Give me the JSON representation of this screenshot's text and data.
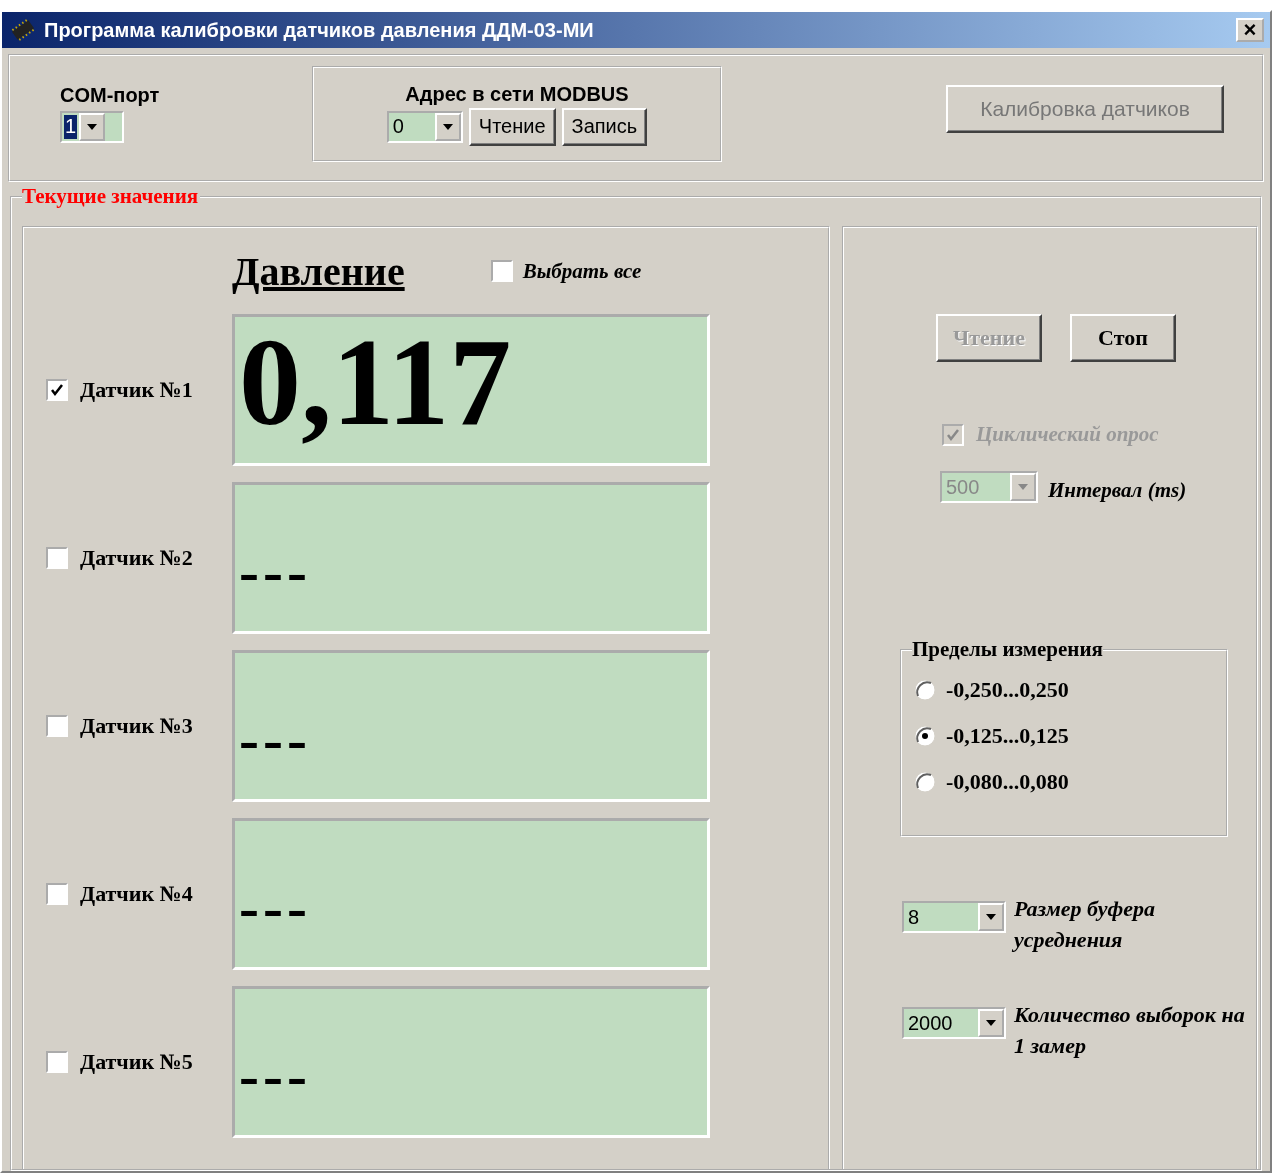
{
  "window": {
    "title": "Программа калибровки датчиков давления ДДМ-03-МИ",
    "close": "×"
  },
  "com_port": {
    "label": "COM-порт",
    "value": "1"
  },
  "modbus": {
    "label": "Адрес в сети MODBUS",
    "address": "0",
    "buttons": [
      "Чтение",
      "Запись"
    ]
  },
  "calibrate_button": "Калибровка датчиков",
  "group_title": "Текущие значения",
  "pressure_heading": "Давление",
  "select_all": {
    "label": "Выбрать все",
    "checked": false
  },
  "sensors": [
    {
      "label": "Датчик №1",
      "checked": true,
      "value": "0,117"
    },
    {
      "label": "Датчик №2",
      "checked": false,
      "value": "---"
    },
    {
      "label": "Датчик №3",
      "checked": false,
      "value": "---"
    },
    {
      "label": "Датчик №4",
      "checked": false,
      "value": "---"
    },
    {
      "label": "Датчик №5",
      "checked": false,
      "value": "---"
    }
  ],
  "read_button": {
    "label": "Чтение",
    "disabled": true
  },
  "stop_button": {
    "label": "Стоп",
    "disabled": false
  },
  "cyclic": {
    "label": "Циклический опрос",
    "checked": true,
    "disabled": true
  },
  "interval": {
    "value": "500",
    "label": "Интервал (ms)",
    "disabled": true
  },
  "ranges": {
    "title": "Пределы измерения",
    "options": [
      {
        "label": "-0,250...0,250",
        "selected": false
      },
      {
        "label": "-0,125...0,125",
        "selected": true
      },
      {
        "label": "-0,080...0,080",
        "selected": false
      }
    ]
  },
  "buffer": {
    "value": "8",
    "label": "Размер буфера усреднения"
  },
  "samples": {
    "value": "2000",
    "label": "Количество выборок на 1 замер"
  }
}
